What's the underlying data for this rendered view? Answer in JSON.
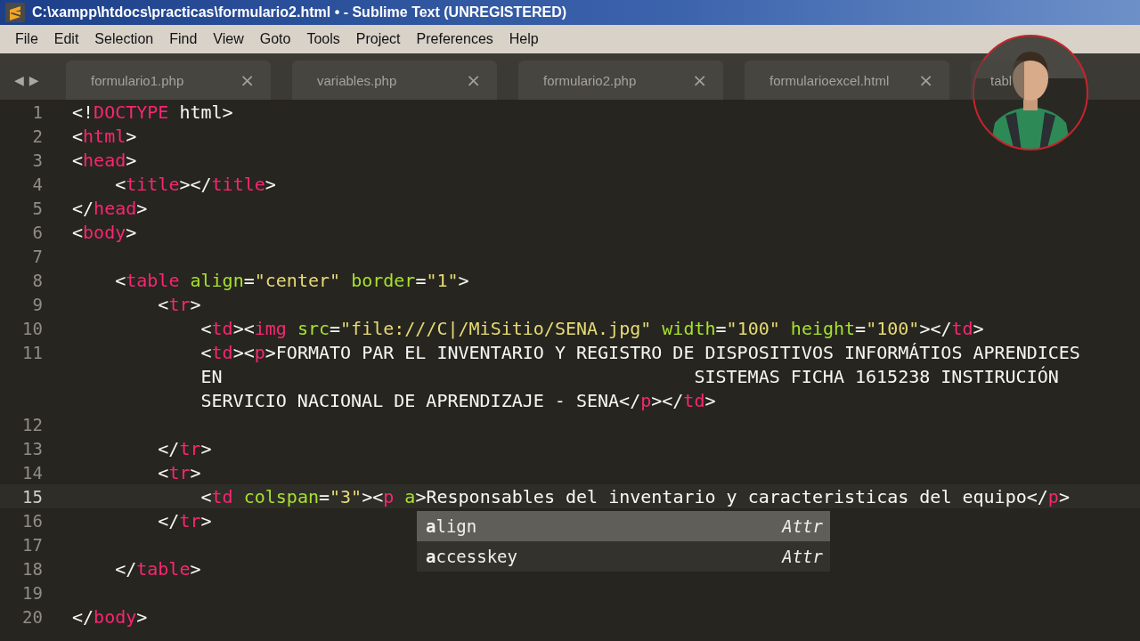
{
  "window": {
    "title": "C:\\xampp\\htdocs\\practicas\\formulario2.html • - Sublime Text (UNREGISTERED)"
  },
  "menu": [
    "File",
    "Edit",
    "Selection",
    "Find",
    "View",
    "Goto",
    "Tools",
    "Project",
    "Preferences",
    "Help"
  ],
  "tab_nav": {
    "back": "◀",
    "forward": "▶"
  },
  "tabs": [
    {
      "label": "formulario1.php",
      "close": "×",
      "selected": false
    },
    {
      "label": "variables.php",
      "close": "×",
      "selected": false
    },
    {
      "label": "formulario2.php",
      "close": "×",
      "selected": false
    },
    {
      "label": "formularioexcel.html",
      "close": "×",
      "selected": false
    },
    {
      "label": "tabl",
      "selected": false
    }
  ],
  "code_lines": [
    {
      "number": "1",
      "current": false,
      "rows": [
        [
          {
            "kind": "punct",
            "text": "<!"
          },
          {
            "kind": "tag",
            "text": "DOCTYPE"
          },
          {
            "kind": "text",
            "text": " html"
          },
          {
            "kind": "punct",
            "text": ">"
          }
        ]
      ]
    },
    {
      "number": "2",
      "current": false,
      "rows": [
        [
          {
            "kind": "punct",
            "text": "<"
          },
          {
            "kind": "tag",
            "text": "html"
          },
          {
            "kind": "punct",
            "text": ">"
          }
        ]
      ]
    },
    {
      "number": "3",
      "current": false,
      "rows": [
        [
          {
            "kind": "punct",
            "text": "<"
          },
          {
            "kind": "tag",
            "text": "head"
          },
          {
            "kind": "punct",
            "text": ">"
          }
        ]
      ]
    },
    {
      "number": "4",
      "current": false,
      "rows": [
        [
          {
            "kind": "punct",
            "text": "    <"
          },
          {
            "kind": "tag",
            "text": "title"
          },
          {
            "kind": "punct",
            "text": "></"
          },
          {
            "kind": "tag",
            "text": "title"
          },
          {
            "kind": "punct",
            "text": ">"
          }
        ]
      ]
    },
    {
      "number": "5",
      "current": false,
      "rows": [
        [
          {
            "kind": "punct",
            "text": "</"
          },
          {
            "kind": "tag",
            "text": "head"
          },
          {
            "kind": "punct",
            "text": ">"
          }
        ]
      ]
    },
    {
      "number": "6",
      "current": false,
      "rows": [
        [
          {
            "kind": "punct",
            "text": "<"
          },
          {
            "kind": "tag",
            "text": "body"
          },
          {
            "kind": "punct",
            "text": ">"
          }
        ]
      ]
    },
    {
      "number": "7",
      "current": false
    },
    {
      "number": "8",
      "current": false,
      "rows": [
        [
          {
            "kind": "punct",
            "text": "    <"
          },
          {
            "kind": "tag",
            "text": "table"
          },
          {
            "kind": "punct",
            "text": " "
          },
          {
            "kind": "attr",
            "text": "align"
          },
          {
            "kind": "punct",
            "text": "="
          },
          {
            "kind": "string",
            "text": "\"center\""
          },
          {
            "kind": "punct",
            "text": " "
          },
          {
            "kind": "attr",
            "text": "border"
          },
          {
            "kind": "punct",
            "text": "="
          },
          {
            "kind": "string",
            "text": "\"1\""
          },
          {
            "kind": "punct",
            "text": ">"
          }
        ]
      ]
    },
    {
      "number": "9",
      "current": false,
      "rows": [
        [
          {
            "kind": "punct",
            "text": "        <"
          },
          {
            "kind": "tag",
            "text": "tr"
          },
          {
            "kind": "punct",
            "text": ">"
          }
        ]
      ]
    },
    {
      "number": "10",
      "current": false,
      "rows": [
        [
          {
            "kind": "punct",
            "text": "            <"
          },
          {
            "kind": "tag",
            "text": "td"
          },
          {
            "kind": "punct",
            "text": "><"
          },
          {
            "kind": "tag",
            "text": "img"
          },
          {
            "kind": "punct",
            "text": " "
          },
          {
            "kind": "attr",
            "text": "src"
          },
          {
            "kind": "punct",
            "text": "="
          },
          {
            "kind": "string",
            "text": "\"file:///C|/MiSitio/SENA.jpg\""
          },
          {
            "kind": "punct",
            "text": " "
          },
          {
            "kind": "attr",
            "text": "width"
          },
          {
            "kind": "punct",
            "text": "="
          },
          {
            "kind": "string",
            "text": "\"100\""
          },
          {
            "kind": "punct",
            "text": " "
          },
          {
            "kind": "attr",
            "text": "height"
          },
          {
            "kind": "punct",
            "text": "="
          },
          {
            "kind": "string",
            "text": "\"100\""
          },
          {
            "kind": "punct",
            "text": "></"
          },
          {
            "kind": "tag",
            "text": "td"
          },
          {
            "kind": "punct",
            "text": ">"
          }
        ]
      ]
    },
    {
      "number": "11",
      "current": false,
      "rows": [
        [
          {
            "kind": "punct",
            "text": "            <"
          },
          {
            "kind": "tag",
            "text": "td"
          },
          {
            "kind": "punct",
            "text": "><"
          },
          {
            "kind": "tag",
            "text": "p"
          },
          {
            "kind": "punct",
            "text": ">"
          },
          {
            "kind": "text",
            "text": "FORMATO PAR EL INVENTARIO Y REGISTRO DE DISPOSITIVOS INFORMÁTIOS APRENDICES"
          }
        ]
      ],
      "wrapped": [
        {
          "kind": "text",
          "text": "            EN                                            SISTEMAS FICHA 1615238 INSTIRUCIÓN"
        },
        {
          "kind": "text",
          "text": "            SERVICIO NACIONAL DE APRENDIZAJE - SENA",
          "tail": [
            {
              "kind": "punct",
              "text": "</"
            },
            {
              "kind": "tag",
              "text": "p"
            },
            {
              "kind": "punct",
              "text": "></"
            },
            {
              "kind": "tag",
              "text": "td"
            },
            {
              "kind": "punct",
              "text": ">"
            }
          ]
        }
      ]
    },
    {
      "number": "12",
      "current": false
    },
    {
      "number": "13",
      "current": false,
      "rows": [
        [
          {
            "kind": "punct",
            "text": "        </"
          },
          {
            "kind": "tag",
            "text": "tr"
          },
          {
            "kind": "punct",
            "text": ">"
          }
        ]
      ]
    },
    {
      "number": "14",
      "current": false,
      "rows": [
        [
          {
            "kind": "punct",
            "text": "        <"
          },
          {
            "kind": "tag",
            "text": "tr"
          },
          {
            "kind": "punct",
            "text": ">"
          }
        ]
      ]
    },
    {
      "number": "15",
      "current": true,
      "rows": [
        [
          {
            "kind": "punct",
            "text": "            <"
          },
          {
            "kind": "tag",
            "text": "td"
          },
          {
            "kind": "punct",
            "text": " "
          },
          {
            "kind": "attr",
            "text": "colspan"
          },
          {
            "kind": "punct",
            "text": "="
          },
          {
            "kind": "string",
            "text": "\"3\""
          },
          {
            "kind": "punct",
            "text": "><"
          },
          {
            "kind": "tag",
            "text": "p"
          },
          {
            "kind": "punct",
            "text": " "
          },
          {
            "kind": "attr",
            "text": "a"
          },
          {
            "kind": "punct",
            "text": ">"
          },
          {
            "kind": "text",
            "text": "Responsables del inventario y caracteristicas del equipo"
          },
          {
            "kind": "punct",
            "text": "</"
          },
          {
            "kind": "tag",
            "text": "p"
          },
          {
            "kind": "punct",
            "text": ">"
          }
        ]
      ]
    },
    {
      "number": "16",
      "current": false,
      "rows": [
        [
          {
            "kind": "punct",
            "text": "        </"
          },
          {
            "kind": "tag",
            "text": "tr"
          },
          {
            "kind": "punct",
            "text": ">"
          }
        ]
      ]
    },
    {
      "number": "17",
      "current": false
    },
    {
      "number": "18",
      "current": false,
      "rows": [
        [
          {
            "kind": "punct",
            "text": "    </"
          },
          {
            "kind": "tag",
            "text": "table"
          },
          {
            "kind": "punct",
            "text": ">"
          }
        ]
      ]
    },
    {
      "number": "19",
      "current": false
    },
    {
      "number": "20",
      "current": false,
      "rows": [
        [
          {
            "kind": "punct",
            "text": "</"
          },
          {
            "kind": "tag",
            "text": "body"
          },
          {
            "kind": "punct",
            "text": ">"
          }
        ]
      ]
    }
  ],
  "autocomplete": [
    {
      "label": "**a**lign",
      "type": "Attr",
      "selected": true
    },
    {
      "label": "**a**ccesskey",
      "type": "Attr",
      "selected": false
    }
  ],
  "webcam": {
    "kind": "picture"
  }
}
